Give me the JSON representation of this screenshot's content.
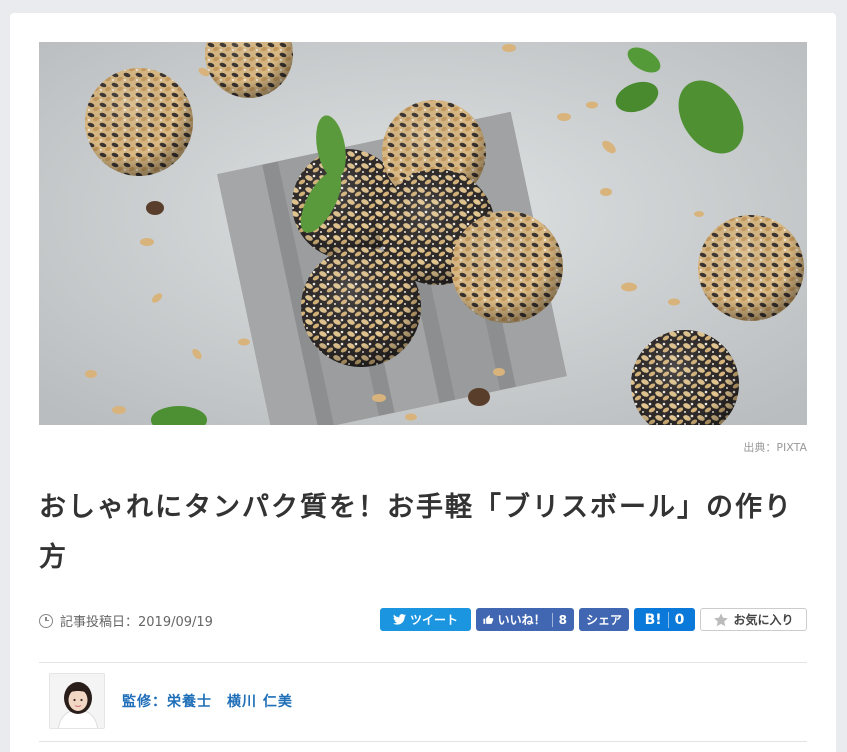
{
  "hero": {
    "alt": "energy balls with oats and mint leaves",
    "credit": "出典：PIXTA"
  },
  "article": {
    "title": "おしゃれにタンパク質を！お手軽「ブリスボール」の作り方",
    "date_label": "記事投稿日：2019/09/19"
  },
  "share": {
    "tweet": "ツイート",
    "like": "いいね！",
    "like_count": "8",
    "share": "シェア",
    "hatena": "B!",
    "hatena_count": "0",
    "favorite": "お気に入り"
  },
  "supervisor": {
    "label": "監修：栄養士　横川 仁美"
  },
  "colors": {
    "twitter": "#1b95e0",
    "facebook": "#4267b2",
    "hatena": "#0a79d9",
    "supervisor_link": "#1e6eb8"
  }
}
